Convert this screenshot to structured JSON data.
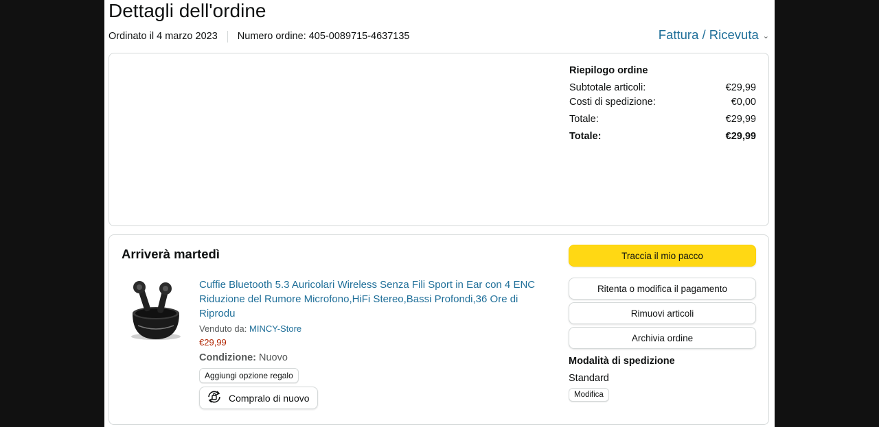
{
  "header": {
    "title": "Dettagli dell'ordine",
    "ordered": "Ordinato il 4 marzo 2023",
    "order_number": "Numero ordine: 405-0089715-4637135",
    "invoice_link": "Fattura / Ricevuta"
  },
  "summary": {
    "heading": "Riepilogo ordine",
    "rows": [
      {
        "label": "Subtotale articoli:",
        "value": "€29,99"
      },
      {
        "label": "Costi di spedizione:",
        "value": "€0,00"
      },
      {
        "label": "Totale:",
        "value": "€29,99"
      },
      {
        "label": "Totale:",
        "value": "€29,99"
      }
    ]
  },
  "shipment": {
    "arrival": "Arriverà martedì",
    "product": {
      "name": "Cuffie Bluetooth 5.3 Auricolari Wireless Senza Fili Sport in Ear con 4 ENC Riduzione del Rumore Microfono,HiFi Stereo,Bassi Profondi,36 Ore di Riprodu",
      "sold_by_label": "Venduto da:",
      "seller": "MINCY-Store",
      "price": "€29,99",
      "condition_label": "Condizione:",
      "condition_value": "Nuovo",
      "gift_button": "Aggiungi opzione regalo",
      "rebuy_button": "Compralo di nuovo"
    },
    "actions": {
      "track": "Traccia il mio pacco",
      "retry_payment": "Ritenta o modifica il pagamento",
      "remove_items": "Rimuovi articoli",
      "archive": "Archivia ordine"
    },
    "shipping": {
      "heading": "Modalità di spedizione",
      "value": "Standard",
      "edit": "Modifica"
    }
  },
  "colors": {
    "link": "#1f6f99",
    "price": "#b12704",
    "primary_button": "#ffd814"
  }
}
